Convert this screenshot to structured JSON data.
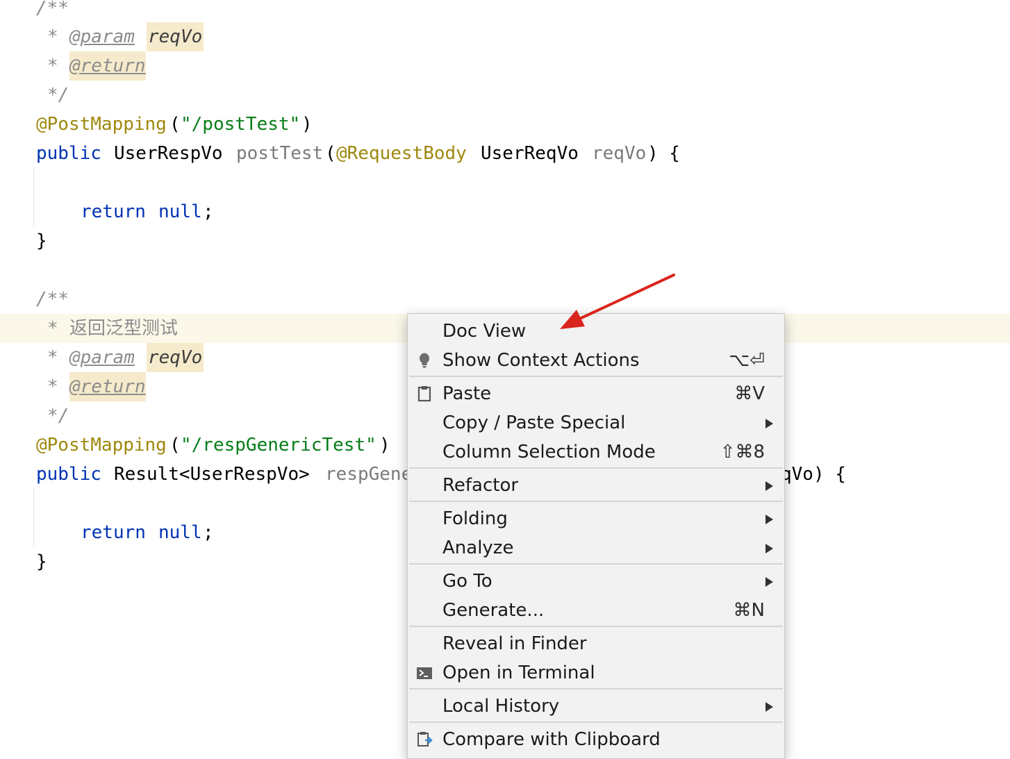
{
  "editor": {
    "block1": {
      "comment_open": "/**",
      "star": "*",
      "param_tag": "@param",
      "param_name": "reqVo",
      "return_tag": "@return",
      "comment_close": "*/",
      "annotation": "@PostMapping",
      "paren_open": "(",
      "mapping_path": "\"/postTest\"",
      "paren_close": ")",
      "sig_public": "public",
      "sig_return_type": "UserRespVo",
      "sig_method": "postTest",
      "sig_paren_open": "(",
      "sig_param_annotation": "@RequestBody",
      "sig_param_type": "UserReqVo",
      "sig_param_name": "reqVo",
      "sig_tail": ") {",
      "return_kw": "return",
      "return_val": "null",
      "semicolon": ";",
      "closing_brace": "}"
    },
    "block2": {
      "comment_open": "/**",
      "star": "*",
      "doc_text": "返回泛型测试",
      "param_tag": "@param",
      "param_name": "reqVo",
      "return_tag": "@return",
      "comment_close": "*/",
      "annotation": "@PostMapping",
      "paren_open": "(",
      "mapping_path": "\"/respGenericTest\"",
      "paren_close": ")",
      "sig_public": "public",
      "sig_return_type": "Result<UserRespVo>",
      "sig_method_partial": "respGene",
      "sig_tail_partial": "qVo) {",
      "return_kw": "return",
      "return_val": "null",
      "semicolon": ";",
      "closing_brace": "}"
    }
  },
  "context_menu": {
    "items": [
      {
        "label": "Doc View",
        "shortcut": "",
        "icon": ""
      },
      {
        "label": "Show Context Actions",
        "shortcut": "⌥⏎",
        "icon": "lightbulb-icon"
      },
      {
        "label": "Paste",
        "shortcut": "⌘V",
        "icon": "clipboard-icon"
      },
      {
        "label": "Copy / Paste Special",
        "shortcut": "",
        "icon": ""
      },
      {
        "label": "Column Selection Mode",
        "shortcut": "⇧⌘8",
        "icon": ""
      },
      {
        "label": "Refactor",
        "shortcut": "",
        "icon": ""
      },
      {
        "label": "Folding",
        "shortcut": "",
        "icon": ""
      },
      {
        "label": "Analyze",
        "shortcut": "",
        "icon": ""
      },
      {
        "label": "Go To",
        "shortcut": "",
        "icon": ""
      },
      {
        "label": "Generate...",
        "shortcut": "⌘N",
        "icon": ""
      },
      {
        "label": "Reveal in Finder",
        "shortcut": "",
        "icon": ""
      },
      {
        "label": "Open in Terminal",
        "shortcut": "",
        "icon": "terminal-icon"
      },
      {
        "label": "Local History",
        "shortcut": "",
        "icon": ""
      },
      {
        "label": "Compare with Clipboard",
        "shortcut": "",
        "icon": "compare-clipboard-icon"
      }
    ]
  },
  "colors": {
    "comment": "#8c8c8c",
    "annotation": "#9e880d",
    "string": "#067d17",
    "keyword": "#0033b3",
    "arrow": "#d9251d",
    "menu_bg": "#f2f2f2",
    "highlight_line": "#fbf8ea"
  }
}
